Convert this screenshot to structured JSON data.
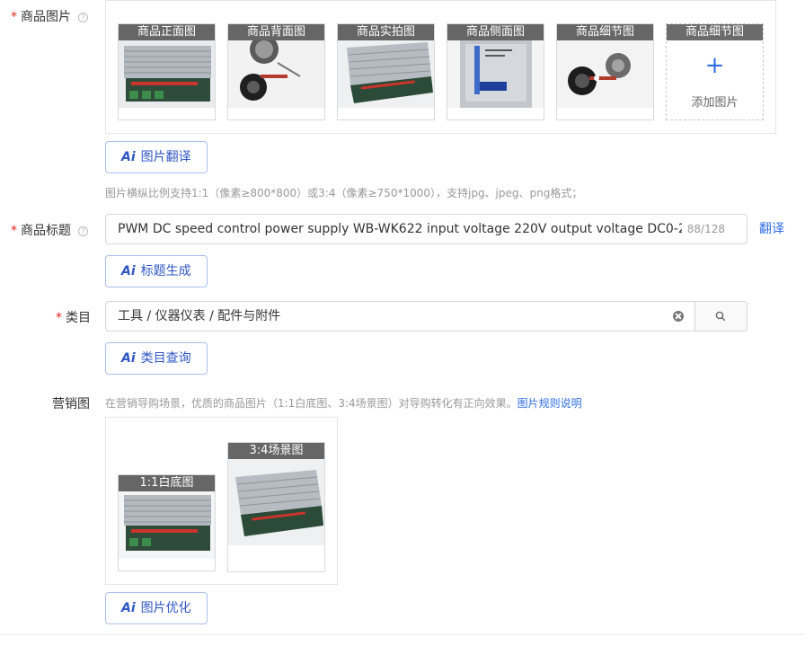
{
  "product_images": {
    "label": "商品图片",
    "help_icon": "question-circle-icon",
    "slots": [
      {
        "caption": "商品正面图",
        "image": "power-supply-front"
      },
      {
        "caption": "商品背面图",
        "image": "knob-back"
      },
      {
        "caption": "商品实拍图",
        "image": "power-supply-photo"
      },
      {
        "caption": "商品侧面图",
        "image": "power-supply-side"
      },
      {
        "caption": "商品细节图",
        "image": "knob-detail"
      },
      {
        "caption": "商品细节图",
        "add_label": "添加图片",
        "icon": "plus-icon"
      }
    ],
    "ai_button": "图片翻译",
    "hint": "图片横纵比例支持1:1（像素≥800*800）或3:4（像素≥750*1000），支持jpg、jpeg、png格式；"
  },
  "title": {
    "label": "商品标题",
    "help_icon": "question-circle-icon",
    "value": "PWM DC speed control power supply WB-WK622 input voltage 220V output voltage DC0-2",
    "count": "88/128",
    "translate_link": "翻译",
    "ai_button": "标题生成"
  },
  "category": {
    "label": "类目",
    "value": "工具 / 仪器仪表 / 配件与附件",
    "clear_icon": "clear-circle-icon",
    "search_icon": "search-icon",
    "ai_button": "类目查询"
  },
  "marketing": {
    "label": "营销图",
    "hint": "在营销导购场景，优质的商品图片（1:1白底图、3:4场景图）对导购转化有正向效果。",
    "hint_link": "图片规则说明",
    "slots": [
      {
        "caption": "1:1白底图",
        "image": "power-supply-white-bg"
      },
      {
        "caption": "3:4场景图",
        "image": "power-supply-scene"
      }
    ],
    "ai_button": "图片优化"
  },
  "ai_badge": "Ai",
  "colors": {
    "accent": "#2f6ee6",
    "required": "#e2231a",
    "caption_bg": "#666666"
  }
}
